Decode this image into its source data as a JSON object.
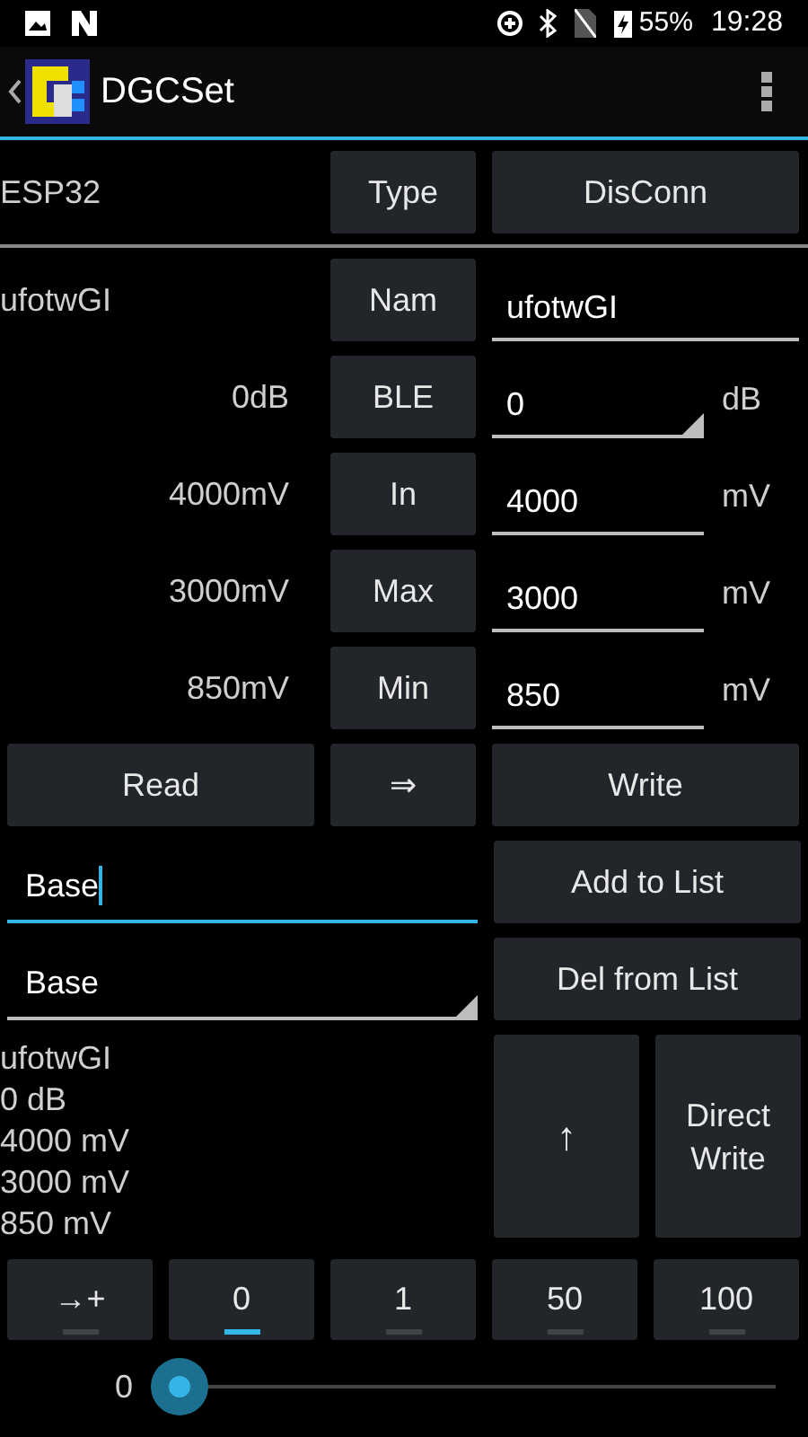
{
  "status_bar": {
    "battery": "55%",
    "time": "19:28"
  },
  "app_bar": {
    "title": "DGCSet"
  },
  "device_row": {
    "device": "ESP32",
    "type_button": "Type",
    "connect_button": "DisConn"
  },
  "name_row": {
    "value_label": "ufotwGI",
    "button": "Nam",
    "field": "ufotwGI"
  },
  "params": [
    {
      "kind": "dropdown",
      "reading": "0dB",
      "button": "BLE",
      "value": "0",
      "unit": "dB"
    },
    {
      "kind": "input",
      "reading": "4000mV",
      "button": "In",
      "value": "4000",
      "unit": "mV"
    },
    {
      "kind": "input",
      "reading": "3000mV",
      "button": "Max",
      "value": "3000",
      "unit": "mV"
    },
    {
      "kind": "input",
      "reading": "850mV",
      "button": "Min",
      "value": "850",
      "unit": "mV"
    }
  ],
  "actions": {
    "read": "Read",
    "arrow": "⇒",
    "write": "Write"
  },
  "list": {
    "name_field": "Base",
    "add_button": "Add to List",
    "selected_entry": "Base",
    "del_button": "Del from List"
  },
  "summary": [
    "ufotwGI",
    "0 dB",
    "4000 mV",
    "3000 mV",
    "850 mV"
  ],
  "up_button": "↑",
  "direct_write_button": "Direct Write",
  "steps": [
    {
      "label": "→+",
      "selected": false
    },
    {
      "label": "0",
      "selected": true
    },
    {
      "label": "1",
      "selected": false
    },
    {
      "label": "50",
      "selected": false
    },
    {
      "label": "100",
      "selected": false
    }
  ],
  "slider": {
    "reading": "0"
  }
}
